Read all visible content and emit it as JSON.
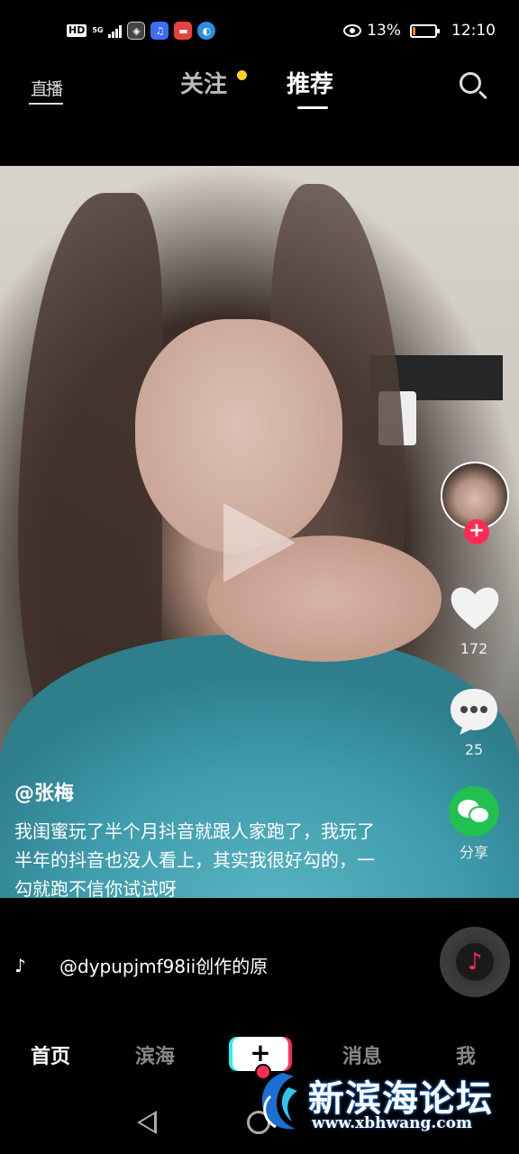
{
  "status_bar": {
    "hd": "HD",
    "network": "5G",
    "battery_percent": "13%",
    "battery_level": 0.13,
    "time": "12:10",
    "app_icons": [
      "app-icon-1",
      "music-app-icon",
      "red-app-icon",
      "browser-icon"
    ]
  },
  "top_nav": {
    "live_label": "直播",
    "tabs": [
      {
        "label": "关注",
        "active": false,
        "has_dot": true
      },
      {
        "label": "推荐",
        "active": true
      }
    ],
    "search_icon": "search-icon"
  },
  "actions": {
    "like_count": "172",
    "comment_count": "25",
    "share_label": "分享",
    "follow_symbol": "+"
  },
  "caption": {
    "author": "@张梅",
    "description": "我闺蜜玩了半个月抖音就跟人家跑了，我玩了半年的抖音也没人看上，其实我很好勾的，一勾就跑不信你试试呀"
  },
  "music": {
    "note": "♪",
    "text": "@dypupjmf98ii创作的原"
  },
  "bottom_nav": {
    "home": "首页",
    "binhai": "滨海",
    "create": "+",
    "messages": "消息",
    "me": "我"
  },
  "watermark": {
    "title": "新滨海论坛",
    "url": "www.xbhwang.com"
  },
  "colors": {
    "accent": "#fe2c55",
    "follow_dot": "#ffd21e",
    "wechat_green": "#20c150",
    "battery": "#ff8a1c"
  }
}
